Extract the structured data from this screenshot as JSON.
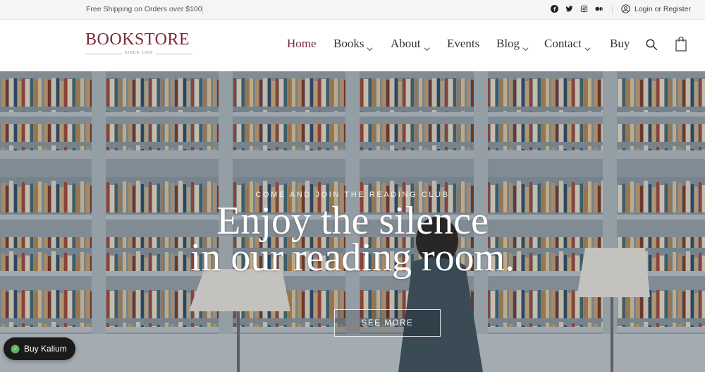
{
  "topbar": {
    "shipping_text": "Free Shipping on Orders over $100",
    "social_icons": [
      "facebook-icon",
      "twitter-icon",
      "instagram-icon",
      "medium-icon"
    ],
    "login_text": "Login or Register"
  },
  "header": {
    "logo_name": "BOOKSTORE",
    "logo_since": "SINCE 1960",
    "brand_color": "#7b2a3a",
    "nav": [
      {
        "label": "Home",
        "active": true,
        "dropdown": false
      },
      {
        "label": "Books",
        "active": false,
        "dropdown": true
      },
      {
        "label": "About",
        "active": false,
        "dropdown": true
      },
      {
        "label": "Events",
        "active": false,
        "dropdown": false
      },
      {
        "label": "Blog",
        "active": false,
        "dropdown": true
      },
      {
        "label": "Contact",
        "active": false,
        "dropdown": true
      },
      {
        "label": "Buy",
        "active": false,
        "dropdown": false
      }
    ]
  },
  "hero": {
    "subtitle": "COME AND JOIN THE READING CLUB",
    "headline_line1": "Enjoy the silence",
    "headline_line2": "in our reading room.",
    "button_label": "SEE MORE"
  },
  "floating": {
    "buy_label": "Buy Kalium",
    "leaf_color": "#5db35d"
  }
}
